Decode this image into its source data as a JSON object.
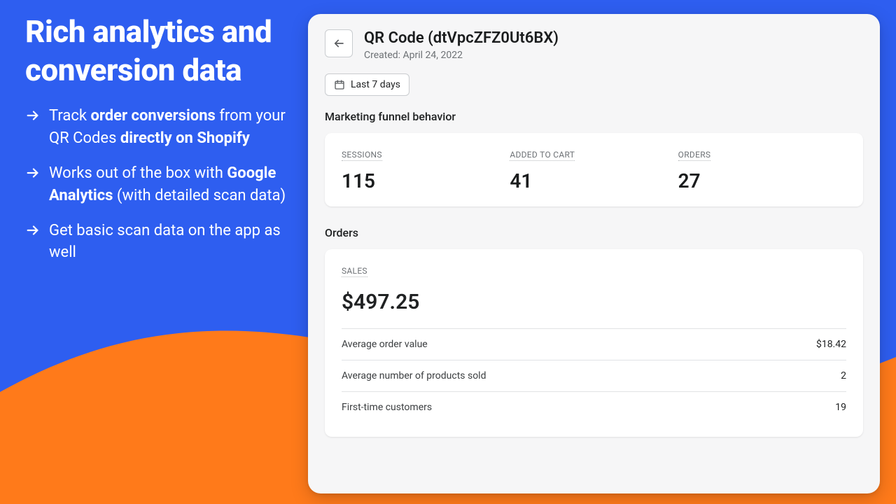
{
  "marketing": {
    "headline": "Rich analytics and conversion data",
    "bullets": [
      {
        "pre": "Track ",
        "b1": "order conversions",
        "mid": " from your QR Codes ",
        "b2": "directly on Shopify",
        "post": ""
      },
      {
        "pre": "Works out of the box with ",
        "b1": "Google Analytics",
        "mid": " (with detailed scan data)",
        "b2": "",
        "post": ""
      },
      {
        "pre": "Get basic scan data on the app as well",
        "b1": "",
        "mid": "",
        "b2": "",
        "post": ""
      }
    ]
  },
  "panel": {
    "title": "QR Code (dtVpcZFZ0Ut6BX)",
    "created": "Created: April 24, 2022",
    "date_range": "Last 7 days",
    "funnel_title": "Marketing funnel behavior",
    "funnel": [
      {
        "label": "SESSIONS",
        "value": "115"
      },
      {
        "label": "ADDED TO CART",
        "value": "41"
      },
      {
        "label": "ORDERS",
        "value": "27"
      }
    ],
    "orders_title": "Orders",
    "sales_label": "SALES",
    "sales_value": "$497.25",
    "rows": [
      {
        "label": "Average order value",
        "value": "$18.42"
      },
      {
        "label": "Average number of products sold",
        "value": "2"
      },
      {
        "label": "First-time customers",
        "value": "19"
      }
    ]
  }
}
